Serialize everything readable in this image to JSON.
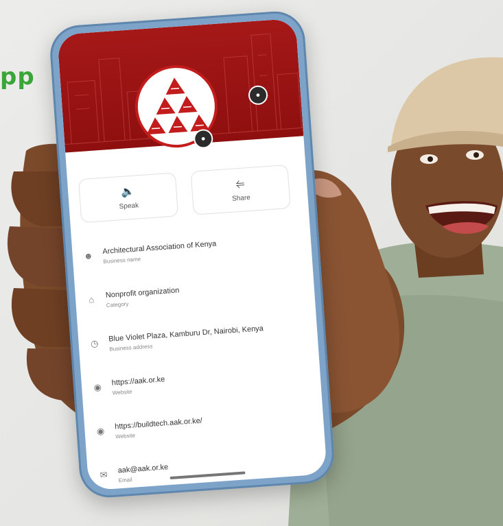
{
  "brand": {
    "partial_text": "pp"
  },
  "profile": {
    "business_name": "Architectural Association of Kenya",
    "business_name_caption": "Business name",
    "category": "Nonprofit organization",
    "category_caption": "Category",
    "address": "Blue Violet Plaza, Kamburu Dr, Nairobi, Kenya",
    "address_caption": "Business address",
    "website_1": "https://aak.or.ke",
    "website_1_caption": "Website",
    "website_2": "https://buildtech.aak.or.ke/",
    "website_2_caption": "Website",
    "email": "aak@aak.or.ke",
    "email_caption": "Email"
  },
  "actions": {
    "speak_label": "Speak",
    "share_label": "Share"
  },
  "icons": {
    "camera": "camera-icon",
    "speaker": "speaker-icon",
    "share": "share-icon",
    "person": "person-icon",
    "store": "store-icon",
    "clock": "clock-icon",
    "globe": "globe-icon",
    "mail": "mail-icon"
  },
  "colors": {
    "header_red": "#a51818",
    "brand_green": "#3aa639",
    "phone_frame": "#7ea3c8",
    "shirt": "#9fae96",
    "cap": "#dcc7a6",
    "skin": "#7a4a2c"
  }
}
